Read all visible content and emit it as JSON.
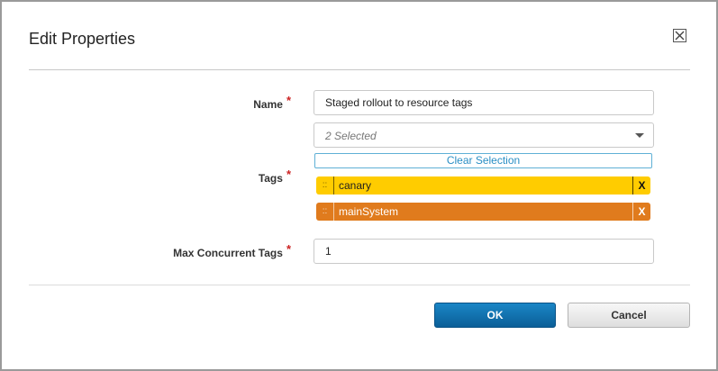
{
  "dialog": {
    "title": "Edit Properties",
    "close_icon": "close-icon"
  },
  "form": {
    "name": {
      "label": "Name",
      "required_mark": "*",
      "value": "Staged rollout to resource tags"
    },
    "tags": {
      "label": "Tags",
      "required_mark": "*",
      "select_value": "2 Selected",
      "clear_label": "Clear Selection",
      "drag_handle_glyph": "::",
      "remove_glyph": "X",
      "items": [
        {
          "label": "canary",
          "color": "#ffcc00"
        },
        {
          "label": "mainSystem",
          "color": "#e07b1d"
        }
      ]
    },
    "max_concurrent": {
      "label": "Max Concurrent Tags",
      "required_mark": "*",
      "value": "1"
    }
  },
  "buttons": {
    "ok_label": "OK",
    "cancel_label": "Cancel"
  },
  "colors": {
    "primary_button": "#0b6fae",
    "required": "#cc2222",
    "link": "#2a8fc5"
  }
}
